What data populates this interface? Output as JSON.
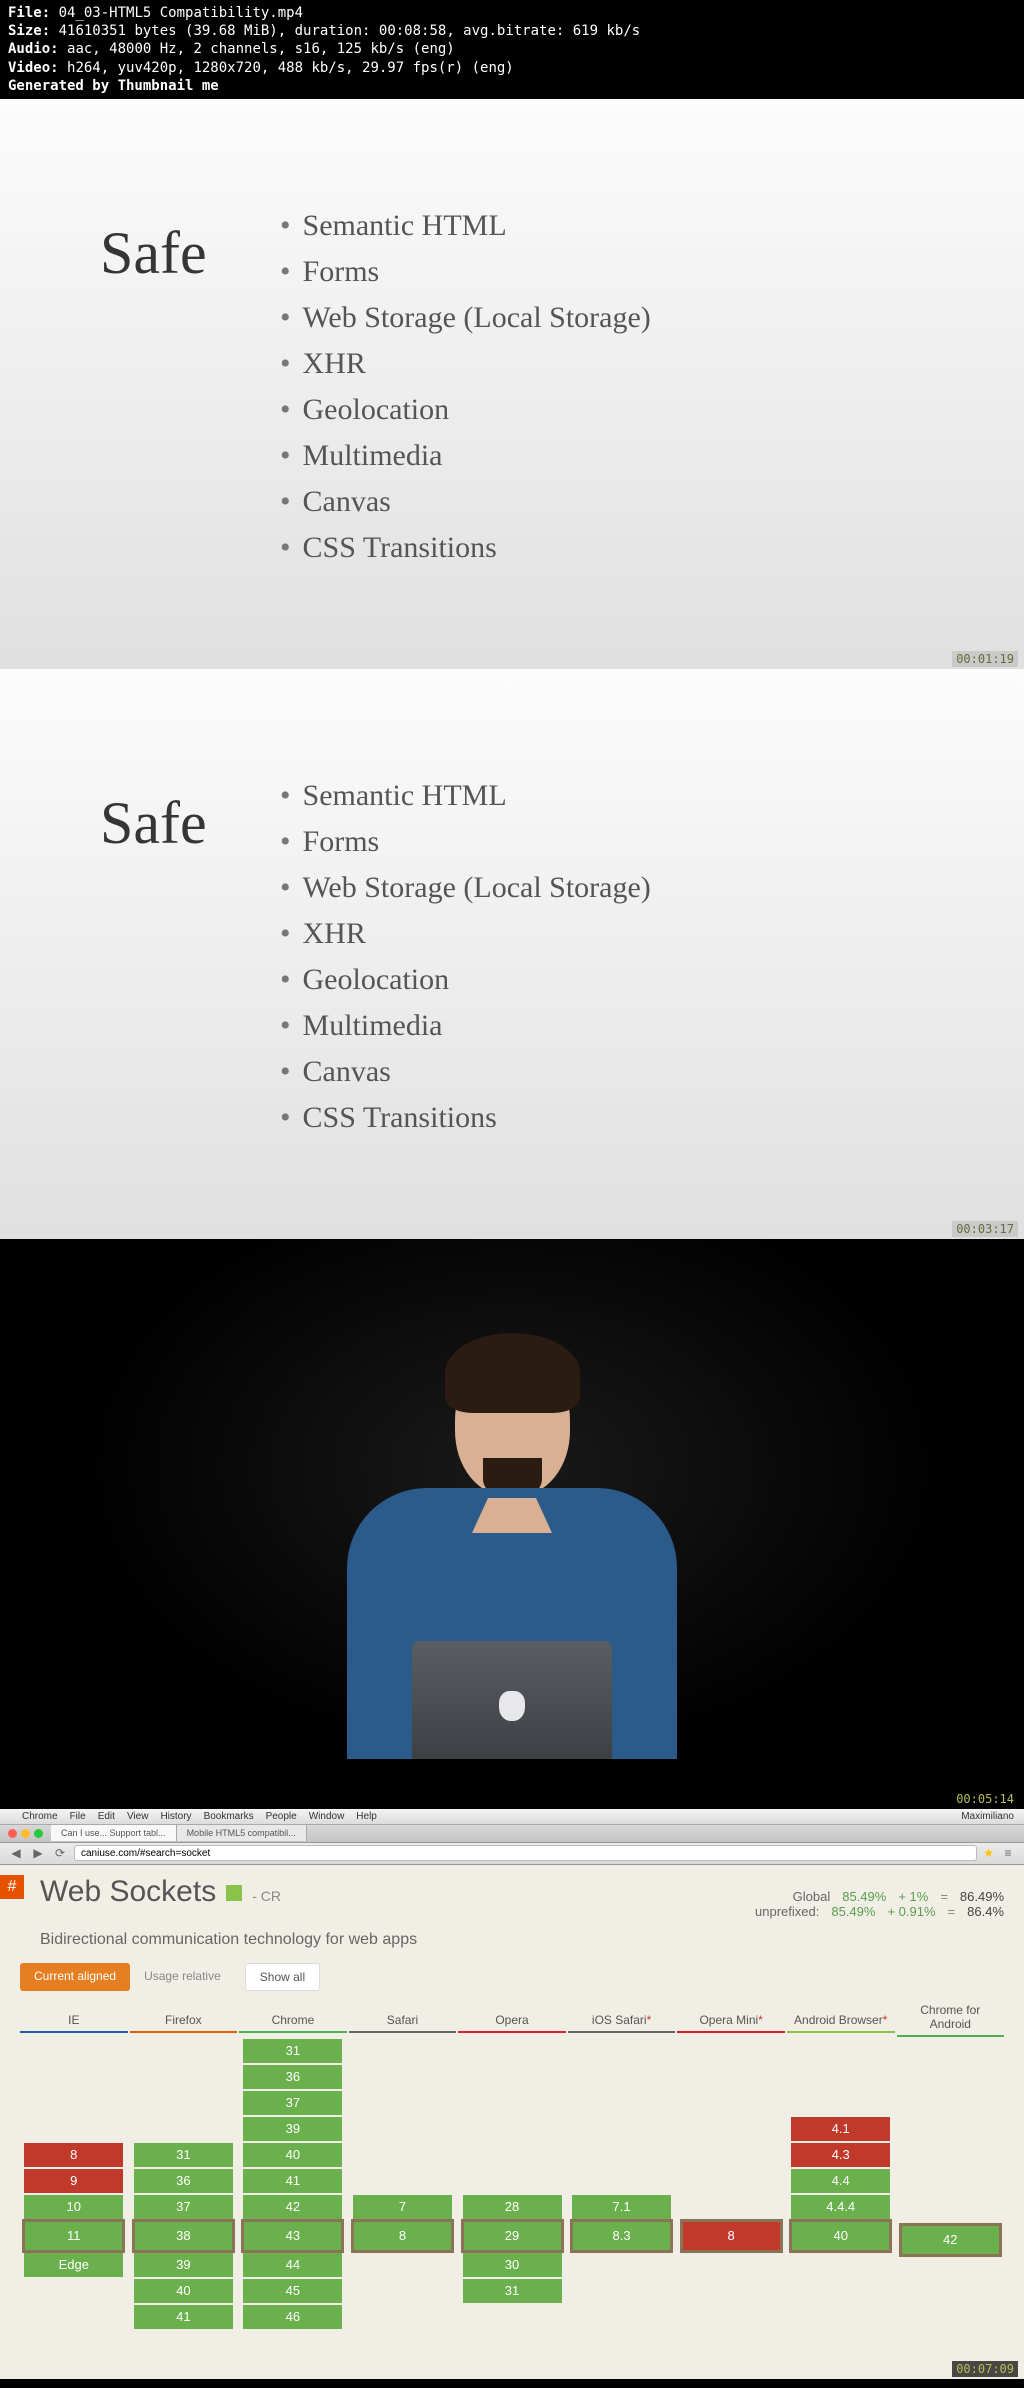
{
  "info": {
    "file_label": "File:",
    "file": "04_03-HTML5 Compatibility.mp4",
    "size_label": "Size:",
    "size": "41610351 bytes (39.68 MiB), duration: 00:08:58, avg.bitrate: 619 kb/s",
    "audio_label": "Audio:",
    "audio": "aac, 48000 Hz, 2 channels, s16, 125 kb/s (eng)",
    "video_label": "Video:",
    "video": "h264, yuv420p, 1280x720, 488 kb/s, 29.97 fps(r) (eng)",
    "gen": "Generated by Thumbnail me"
  },
  "slide1": {
    "title": "Safe",
    "items": [
      "Semantic HTML",
      "Forms",
      "Web Storage (Local Storage)",
      "XHR",
      "Geolocation",
      "Multimedia",
      "Canvas",
      "CSS Transitions"
    ],
    "ts": "00:01:19"
  },
  "slide2": {
    "title": "Safe",
    "items": [
      "Semantic HTML",
      "Forms",
      "Web Storage (Local Storage)",
      "XHR",
      "Geolocation",
      "Multimedia",
      "Canvas",
      "CSS Transitions"
    ],
    "ts": "00:03:17"
  },
  "speaker": {
    "ts": "00:05:14"
  },
  "browser": {
    "menubar": [
      "Chrome",
      "File",
      "Edit",
      "View",
      "History",
      "Bookmarks",
      "People",
      "Window",
      "Help"
    ],
    "menubar_right": "Maximiliano",
    "tabs": [
      "Can I use... Support tabl...",
      "Mobile HTML5 compatibil..."
    ],
    "url": "caniuse.com/#search=socket",
    "ts": "00:07:09",
    "caniuse": {
      "title": "Web Sockets",
      "cr": "- CR",
      "global_label": "Global",
      "unprefixed_label": "unprefixed:",
      "global_row1": {
        "a": "85.49%",
        "b": "+ 1%",
        "c": "=",
        "d": "86.49%"
      },
      "global_row2": {
        "a": "85.49%",
        "b": "+ 0.91%",
        "c": "=",
        "d": "86.4%"
      },
      "desc": "Bidirectional communication technology for web apps",
      "tabs": [
        "Current aligned",
        "Usage relative",
        "Show all"
      ],
      "browsers": [
        {
          "name": "IE",
          "cells": [
            {
              "t": "",
              "c": "empty"
            },
            {
              "t": "",
              "c": "empty"
            },
            {
              "t": "",
              "c": "empty"
            },
            {
              "t": "",
              "c": "empty"
            },
            {
              "t": "8",
              "c": "red"
            },
            {
              "t": "9",
              "c": "red"
            },
            {
              "t": "10",
              "c": "green"
            },
            {
              "t": "11",
              "c": "green",
              "cur": true
            },
            {
              "t": "Edge",
              "c": "green"
            },
            {
              "t": "",
              "c": "empty"
            },
            {
              "t": "",
              "c": "empty"
            }
          ]
        },
        {
          "name": "Firefox",
          "cells": [
            {
              "t": "",
              "c": "empty"
            },
            {
              "t": "",
              "c": "empty"
            },
            {
              "t": "",
              "c": "empty"
            },
            {
              "t": "",
              "c": "empty"
            },
            {
              "t": "31",
              "c": "green"
            },
            {
              "t": "36",
              "c": "green"
            },
            {
              "t": "37",
              "c": "green"
            },
            {
              "t": "38",
              "c": "green",
              "cur": true
            },
            {
              "t": "39",
              "c": "green"
            },
            {
              "t": "40",
              "c": "green"
            },
            {
              "t": "41",
              "c": "green"
            }
          ]
        },
        {
          "name": "Chrome",
          "cells": [
            {
              "t": "31",
              "c": "green"
            },
            {
              "t": "36",
              "c": "green"
            },
            {
              "t": "37",
              "c": "green"
            },
            {
              "t": "39",
              "c": "green"
            },
            {
              "t": "40",
              "c": "green"
            },
            {
              "t": "41",
              "c": "green"
            },
            {
              "t": "42",
              "c": "green"
            },
            {
              "t": "43",
              "c": "green",
              "cur": true
            },
            {
              "t": "44",
              "c": "green"
            },
            {
              "t": "45",
              "c": "green"
            },
            {
              "t": "46",
              "c": "green"
            }
          ]
        },
        {
          "name": "Safari",
          "cells": [
            {
              "t": "",
              "c": "empty"
            },
            {
              "t": "",
              "c": "empty"
            },
            {
              "t": "",
              "c": "empty"
            },
            {
              "t": "",
              "c": "empty"
            },
            {
              "t": "",
              "c": "empty"
            },
            {
              "t": "",
              "c": "empty"
            },
            {
              "t": "7",
              "c": "green"
            },
            {
              "t": "8",
              "c": "green",
              "cur": true
            },
            {
              "t": "",
              "c": "empty"
            },
            {
              "t": "",
              "c": "empty"
            },
            {
              "t": "",
              "c": "empty"
            }
          ]
        },
        {
          "name": "Opera",
          "cells": [
            {
              "t": "",
              "c": "empty"
            },
            {
              "t": "",
              "c": "empty"
            },
            {
              "t": "",
              "c": "empty"
            },
            {
              "t": "",
              "c": "empty"
            },
            {
              "t": "",
              "c": "empty"
            },
            {
              "t": "",
              "c": "empty"
            },
            {
              "t": "28",
              "c": "green"
            },
            {
              "t": "29",
              "c": "green",
              "cur": true
            },
            {
              "t": "30",
              "c": "green"
            },
            {
              "t": "31",
              "c": "green"
            },
            {
              "t": "",
              "c": "empty"
            }
          ]
        },
        {
          "name": "iOS Safari",
          "ast": true,
          "cells": [
            {
              "t": "",
              "c": "empty"
            },
            {
              "t": "",
              "c": "empty"
            },
            {
              "t": "",
              "c": "empty"
            },
            {
              "t": "",
              "c": "empty"
            },
            {
              "t": "",
              "c": "empty"
            },
            {
              "t": "",
              "c": "empty"
            },
            {
              "t": "7.1",
              "c": "green"
            },
            {
              "t": "8.3",
              "c": "green",
              "cur": true
            },
            {
              "t": "",
              "c": "empty"
            },
            {
              "t": "",
              "c": "empty"
            },
            {
              "t": "",
              "c": "empty"
            }
          ]
        },
        {
          "name": "Opera Mini",
          "ast": true,
          "cells": [
            {
              "t": "",
              "c": "empty"
            },
            {
              "t": "",
              "c": "empty"
            },
            {
              "t": "",
              "c": "empty"
            },
            {
              "t": "",
              "c": "empty"
            },
            {
              "t": "",
              "c": "empty"
            },
            {
              "t": "",
              "c": "empty"
            },
            {
              "t": "",
              "c": "empty"
            },
            {
              "t": "8",
              "c": "red",
              "cur": true
            },
            {
              "t": "",
              "c": "empty"
            },
            {
              "t": "",
              "c": "empty"
            },
            {
              "t": "",
              "c": "empty"
            }
          ]
        },
        {
          "name": "Android Browser",
          "ast": true,
          "cells": [
            {
              "t": "",
              "c": "empty"
            },
            {
              "t": "",
              "c": "empty"
            },
            {
              "t": "",
              "c": "empty"
            },
            {
              "t": "4.1",
              "c": "red"
            },
            {
              "t": "4.3",
              "c": "red"
            },
            {
              "t": "4.4",
              "c": "green"
            },
            {
              "t": "4.4.4",
              "c": "green"
            },
            {
              "t": "40",
              "c": "green",
              "cur": true
            },
            {
              "t": "",
              "c": "empty"
            },
            {
              "t": "",
              "c": "empty"
            },
            {
              "t": "",
              "c": "empty"
            }
          ]
        },
        {
          "name": "Chrome for Android",
          "cells": [
            {
              "t": "",
              "c": "empty"
            },
            {
              "t": "",
              "c": "empty"
            },
            {
              "t": "",
              "c": "empty"
            },
            {
              "t": "",
              "c": "empty"
            },
            {
              "t": "",
              "c": "empty"
            },
            {
              "t": "",
              "c": "empty"
            },
            {
              "t": "",
              "c": "empty"
            },
            {
              "t": "42",
              "c": "green",
              "cur": true
            },
            {
              "t": "",
              "c": "empty"
            },
            {
              "t": "",
              "c": "empty"
            },
            {
              "t": "",
              "c": "empty"
            }
          ]
        }
      ]
    }
  }
}
